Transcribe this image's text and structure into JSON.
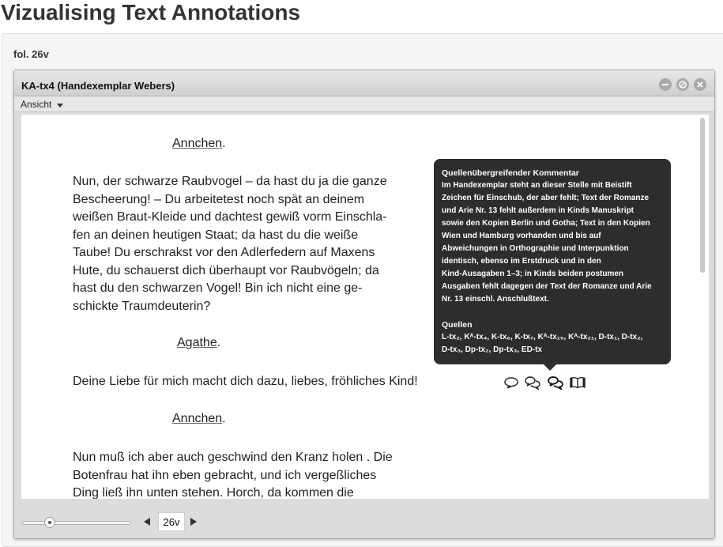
{
  "page": {
    "title": "Vizualising Text Annotations"
  },
  "panel": {
    "heading": "fol. 26v"
  },
  "viewer": {
    "window_title": "KA-tx4 (Handexemplar Webers)",
    "menu_label": "Ansicht",
    "buttons": {
      "minimize_icon": "minus-circle",
      "maximize_icon": "maximize-circle",
      "close_icon": "close-circle"
    }
  },
  "text": {
    "speaker1": "Annchen",
    "speaker1_punct": ".",
    "para1": [
      "Nun, der schwarze Raubvogel – da hast du ja die ganze",
      "Bescheerung! – Du arbeitetest noch spät an deinem",
      "weißen Braut-Kleide und dachtest gewiß vorm Einschla-",
      "fen an deinen heutigen Staat; da hast du die weiße",
      "Taube! Du erschrakst vor den Adlerfedern auf Maxens",
      "Hute, du schauerst dich überhaupt vor Raubvögeln; da",
      "hast du den schwarzen Vogel! Bin ich nicht eine ge-",
      "schickte Traumdeuterin?"
    ],
    "speaker2": "Agathe",
    "speaker2_punct": ".",
    "para2": [
      "Deine Liebe für mich macht dich dazu, liebes, fröhliches Kind!"
    ],
    "speaker3": "Annchen",
    "speaker3_punct": ".",
    "para3": [
      "Nun muß ich aber auch geschwind den Kranz holen . Die",
      "Botenfrau hat ihn eben gebracht, und ich vergeßliches",
      "Ding ließ ihn unten stehen. Horch, da kommen die"
    ]
  },
  "tooltip": {
    "heading": "Quellenübergreifender Kommentar",
    "body": [
      "Im Handexemplar steht an dieser Stelle mit Beistift",
      "Zeichen für Einschub, der aber fehlt; Text der Romanze",
      "und Arie Nr. 13 fehlt außerdem in Kinds Manuskript",
      "sowie den Kopien Berlin und Gotha; Text in den Kopien",
      "Wien und Hamburg vorhanden und bis auf",
      "Abweichungen in Orthographie und Interpunktion",
      "identisch, ebenso im Erstdruck und in den",
      "Kind-Ausagaben 1–3; in Kinds beiden postumen",
      "Ausgaben fehlt dagegen der Text der Romanze und Arie",
      "Nr. 13 einschl. Anschlußtext."
    ],
    "sources_heading": "Quellen",
    "sources_line1": "L-tx₂, Kᴬ-tx₄, K-tx₆, K-tx₇, Kᴬ-tx₁₅, Kᴬ-tx₂₁, D-tx₁, D-tx₂,",
    "sources_line2": "D-tx₃, Dp-tx₂, Dp-tx₃, ED-tx"
  },
  "annotation_icons": [
    "comment-icon",
    "comments-icon",
    "comments-selected-icon",
    "book-icon"
  ],
  "bottom": {
    "page_value": "26v",
    "slider_position": 0.25
  }
}
